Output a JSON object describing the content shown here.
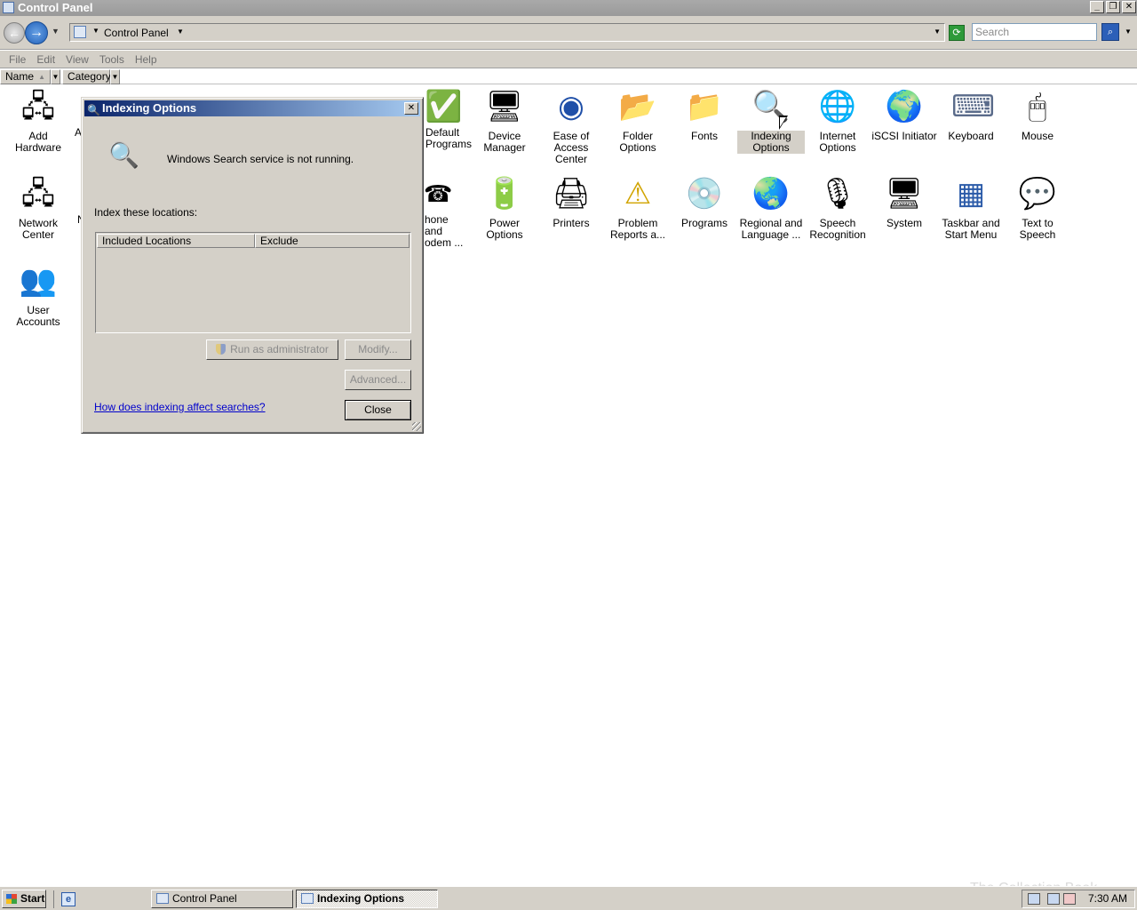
{
  "window": {
    "title": "Control Panel"
  },
  "address": {
    "crumb": "Control Panel",
    "search_placeholder": "Search"
  },
  "menu": [
    "File",
    "Edit",
    "View",
    "Tools",
    "Help"
  ],
  "columns": {
    "name": "Name",
    "category": "Category"
  },
  "items": [
    {
      "label": "Add Hardware",
      "icon": "add-hardware-icon",
      "glyph": "🖧"
    },
    {
      "label": "A",
      "icon": "partially-hidden-icon",
      "glyph": ""
    },
    {
      "label": "Default Programs",
      "icon": "default-programs-icon",
      "glyph": "✅"
    },
    {
      "label": "Device Manager",
      "icon": "device-manager-icon",
      "glyph": "🖥"
    },
    {
      "label": "Ease of Access Center",
      "icon": "ease-of-access-icon",
      "glyph": "◉"
    },
    {
      "label": "Folder Options",
      "icon": "folder-options-icon",
      "glyph": "📂"
    },
    {
      "label": "Fonts",
      "icon": "fonts-icon",
      "glyph": "📁"
    },
    {
      "label": "Indexing Options",
      "icon": "indexing-options-icon",
      "glyph": "🔍"
    },
    {
      "label": "Internet Options",
      "icon": "internet-options-icon",
      "glyph": "🌐"
    },
    {
      "label": "iSCSI Initiator",
      "icon": "iscsi-initiator-icon",
      "glyph": "🌍"
    },
    {
      "label": "Keyboard",
      "icon": "keyboard-icon",
      "glyph": "⌨"
    },
    {
      "label": "Mouse",
      "icon": "mouse-icon",
      "glyph": "🖱"
    },
    {
      "label": "Network Center",
      "icon": "network-center-icon",
      "glyph": "🖧"
    },
    {
      "label": "N",
      "icon": "partially-hidden-icon",
      "glyph": ""
    },
    {
      "label": "hone and odem ...",
      "icon": "phone-modem-icon",
      "glyph": "☎"
    },
    {
      "label": "Power Options",
      "icon": "power-options-icon",
      "glyph": "🔋"
    },
    {
      "label": "Printers",
      "icon": "printers-icon",
      "glyph": "🖨"
    },
    {
      "label": "Problem Reports a...",
      "icon": "problem-reports-icon",
      "glyph": "⚠"
    },
    {
      "label": "Programs",
      "icon": "programs-icon",
      "glyph": "💿"
    },
    {
      "label": "Regional and Language ...",
      "icon": "regional-language-icon",
      "glyph": "🌏"
    },
    {
      "label": "Speech Recognition",
      "icon": "microphone-icon",
      "glyph": "🎙"
    },
    {
      "label": "System",
      "icon": "system-icon",
      "glyph": "🖥"
    },
    {
      "label": "Taskbar and Start Menu",
      "icon": "taskbar-icon",
      "glyph": "▦"
    },
    {
      "label": "Text to Speech",
      "icon": "text-to-speech-icon",
      "glyph": "💬"
    },
    {
      "label": "User Accounts",
      "icon": "user-accounts-icon",
      "glyph": "👥"
    }
  ],
  "dialog": {
    "title": "Indexing Options",
    "status": "Windows Search service is not running.",
    "index_label": "Index these locations:",
    "col_included": "Included Locations",
    "col_exclude": "Exclude",
    "run_admin": "Run as administrator",
    "modify": "Modify...",
    "advanced": "Advanced...",
    "help_link": "How does indexing affect searches?",
    "close": "Close"
  },
  "taskbar": {
    "start": "Start",
    "tasks": [
      "Control Panel",
      "Indexing Options"
    ],
    "clock": "7:30 AM"
  },
  "watermark": "The Collection Book"
}
